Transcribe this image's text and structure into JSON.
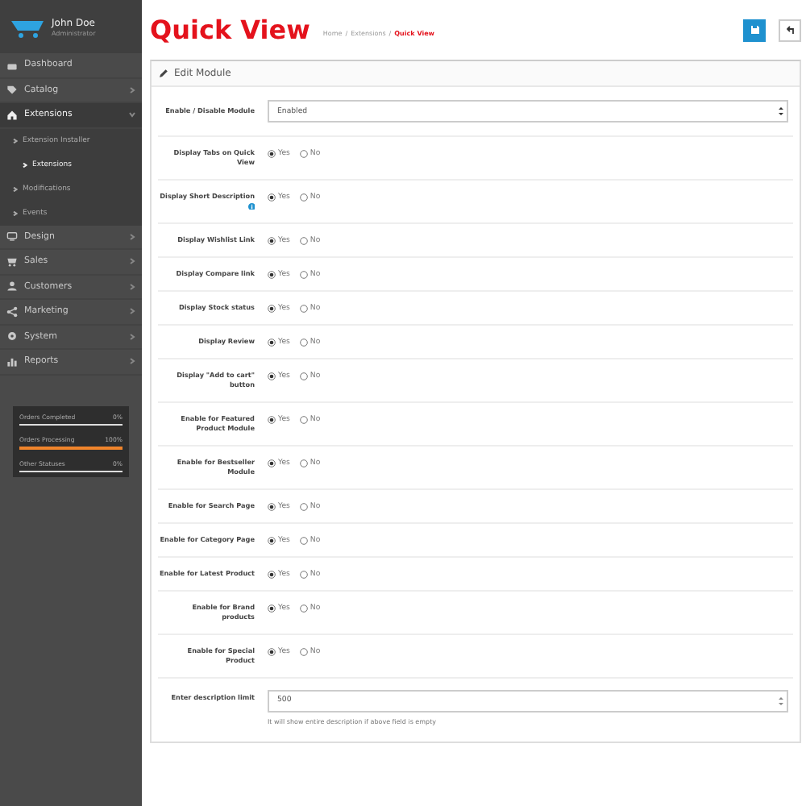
{
  "sidebar": {
    "user": {
      "name": "John Doe",
      "role": "Administrator"
    },
    "menu": [
      {
        "label": "Dashboard"
      },
      {
        "label": "Catalog",
        "expanded": false
      },
      {
        "label": "Extensions",
        "expanded": true,
        "children": [
          {
            "label": "Extension Installer",
            "selected": false
          },
          {
            "label": "Extensions",
            "selected": true
          },
          {
            "label": "Modifications",
            "selected": false
          },
          {
            "label": "Events",
            "selected": false
          }
        ]
      },
      {
        "label": "Design",
        "expanded": false
      },
      {
        "label": "Sales",
        "expanded": false
      },
      {
        "label": "Customers",
        "expanded": false
      },
      {
        "label": "Marketing",
        "expanded": false
      },
      {
        "label": "System",
        "expanded": false
      },
      {
        "label": "Reports",
        "expanded": false
      }
    ],
    "stats": [
      {
        "label": "Orders Completed",
        "reading": "0%",
        "level": 0
      },
      {
        "label": "Orders Processing",
        "reading": "100%",
        "level": 1
      },
      {
        "label": "Other Statuses",
        "reading": "0%",
        "level": 0
      }
    ]
  },
  "page": {
    "title": "Quick View",
    "breadcrumb_separator": "/",
    "breadcrumb": [
      {
        "label": "Home",
        "selected": false
      },
      {
        "label": "Extensions",
        "selected": false
      },
      {
        "label": "Quick View",
        "selected": true
      }
    ]
  },
  "panel": {
    "title": "Edit Module",
    "fields": [
      {
        "kind": "select",
        "label": "Enable / Disable Module",
        "value": "Enabled"
      },
      {
        "kind": "radio",
        "label": "Display Tabs on Quick View",
        "options": [
          {
            "label": "Yes",
            "selected": true
          },
          {
            "label": "No",
            "selected": false
          }
        ]
      },
      {
        "kind": "radio",
        "label": "Display Short Description",
        "info": true,
        "options": [
          {
            "label": "Yes",
            "selected": true
          },
          {
            "label": "No",
            "selected": false
          }
        ]
      },
      {
        "kind": "radio",
        "label": "Display Wishlist Link",
        "options": [
          {
            "label": "Yes",
            "selected": true
          },
          {
            "label": "No",
            "selected": false
          }
        ]
      },
      {
        "kind": "radio",
        "label": "Display Compare link",
        "options": [
          {
            "label": "Yes",
            "selected": true
          },
          {
            "label": "No",
            "selected": false
          }
        ]
      },
      {
        "kind": "radio",
        "label": "Display Stock status",
        "options": [
          {
            "label": "Yes",
            "selected": true
          },
          {
            "label": "No",
            "selected": false
          }
        ]
      },
      {
        "kind": "radio",
        "label": "Display Review",
        "options": [
          {
            "label": "Yes",
            "selected": true
          },
          {
            "label": "No",
            "selected": false
          }
        ]
      },
      {
        "kind": "radio",
        "label": "Display \"Add to cart\" button",
        "options": [
          {
            "label": "Yes",
            "selected": true
          },
          {
            "label": "No",
            "selected": false
          }
        ]
      },
      {
        "kind": "radio",
        "label": "Enable for Featured Product Module",
        "options": [
          {
            "label": "Yes",
            "selected": true
          },
          {
            "label": "No",
            "selected": false
          }
        ]
      },
      {
        "kind": "radio",
        "label": "Enable for Bestseller Module",
        "options": [
          {
            "label": "Yes",
            "selected": true
          },
          {
            "label": "No",
            "selected": false
          }
        ]
      },
      {
        "kind": "radio",
        "label": "Enable for Search Page",
        "options": [
          {
            "label": "Yes",
            "selected": true
          },
          {
            "label": "No",
            "selected": false
          }
        ]
      },
      {
        "kind": "radio",
        "label": "Enable for Category Page",
        "options": [
          {
            "label": "Yes",
            "selected": true
          },
          {
            "label": "No",
            "selected": false
          }
        ]
      },
      {
        "kind": "radio",
        "label": "Enable for Latest Product",
        "options": [
          {
            "label": "Yes",
            "selected": true
          },
          {
            "label": "No",
            "selected": false
          }
        ]
      },
      {
        "kind": "radio",
        "label": "Enable for Brand products",
        "options": [
          {
            "label": "Yes",
            "selected": true
          },
          {
            "label": "No",
            "selected": false
          }
        ]
      },
      {
        "kind": "radio",
        "label": "Enable for Special Product",
        "options": [
          {
            "label": "Yes",
            "selected": true
          },
          {
            "label": "No",
            "selected": false
          }
        ]
      },
      {
        "kind": "number",
        "label": "Enter description limit",
        "value": "500",
        "help": "It will show entire description if above field is empty"
      }
    ]
  }
}
